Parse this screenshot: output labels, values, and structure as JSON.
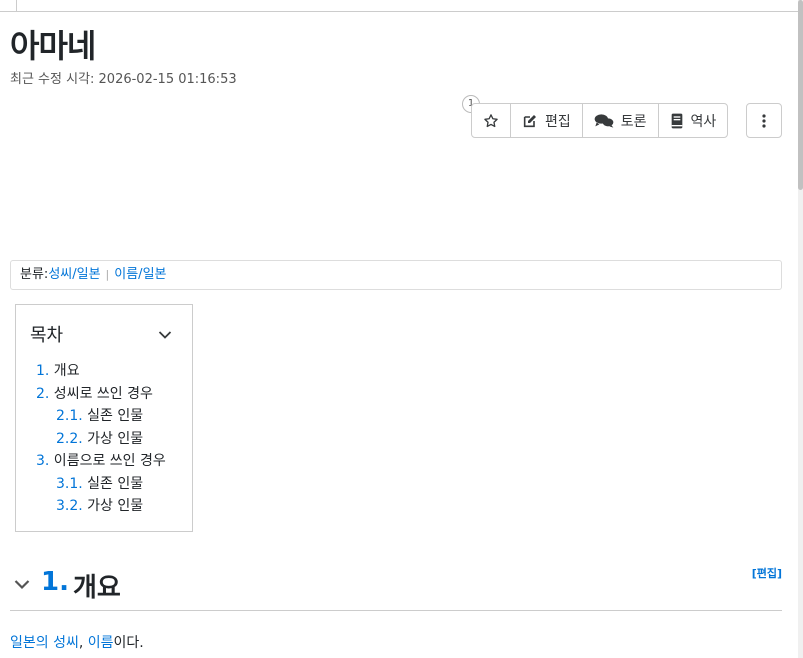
{
  "page": {
    "title": "아마네",
    "last_modified": "최근 수정 시각: 2026-02-15 01:16:53"
  },
  "actions": {
    "star_count": "1",
    "edit_label": "편집",
    "discuss_label": "토론",
    "history_label": "역사"
  },
  "category": {
    "label": "분류:",
    "items": [
      "성씨/일본",
      "이름/일본"
    ]
  },
  "toc": {
    "title": "목차",
    "items": [
      {
        "num": "1.",
        "text": " 개요"
      },
      {
        "num": "2.",
        "text": " 성씨로 쓰인 경우"
      },
      {
        "num": "2.1.",
        "text": " 실존 인물"
      },
      {
        "num": "2.2.",
        "text": " 가상 인물"
      },
      {
        "num": "3.",
        "text": " 이름으로 쓰인 경우"
      },
      {
        "num": "3.1.",
        "text": " 실존 인물"
      },
      {
        "num": "3.2.",
        "text": " 가상 인물"
      }
    ]
  },
  "section1": {
    "num": "1.",
    "title": "개요",
    "edit_label": "[편집]",
    "body": {
      "link1": "일본의 성씨",
      "sep": ", ",
      "link2": "이름",
      "tail": "이다."
    }
  },
  "colors": {
    "link": "#0275d8",
    "text": "#212529",
    "border": "#cccccc"
  }
}
